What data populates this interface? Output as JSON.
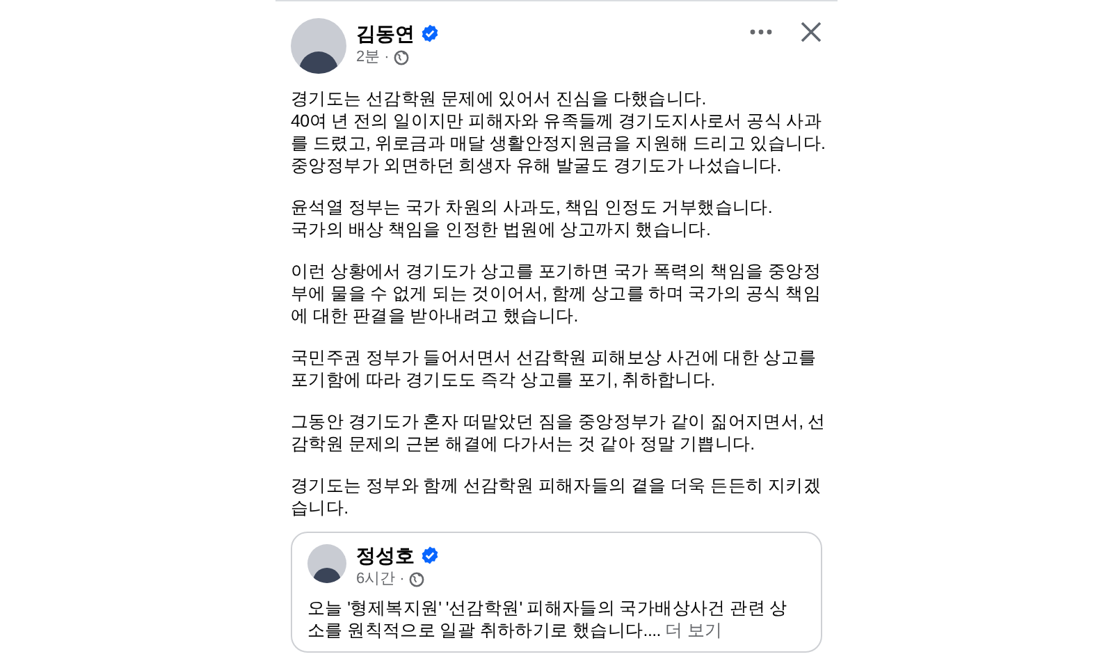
{
  "post": {
    "author": "김동연",
    "verified": true,
    "time": "2분",
    "separator": "·",
    "paragraphs": [
      [
        "경기도는 선감학원 문제에 있어서 진심을 다했습니다.",
        "40여 년 전의 일이지만 피해자와 유족들께 경기도지사로서 공식 사과",
        "를 드렸고, 위로금과 매달 생활안정지원금을 지원해 드리고 있습니다.",
        "중앙정부가 외면하던 희생자 유해 발굴도 경기도가 나섰습니다."
      ],
      [
        "윤석열 정부는 국가 차원의 사과도, 책임 인정도 거부했습니다.",
        "국가의 배상 책임을 인정한 법원에 상고까지 했습니다."
      ],
      [
        "이런 상황에서 경기도가 상고를 포기하면 국가 폭력의 책임을 중앙정",
        "부에 물을 수 없게 되는 것이어서, 함께 상고를 하며 국가의 공식 책임",
        "에 대한 판결을 받아내려고 했습니다."
      ],
      [
        "국민주권 정부가 들어서면서 선감학원 피해보상 사건에 대한 상고를",
        "포기함에 따라 경기도도 즉각 상고를 포기, 취하합니다."
      ],
      [
        "그동안 경기도가 혼자 떠맡았던 짐을 중앙정부가 같이 짊어지면서, 선",
        "감학원 문제의 근본 해결에 다가서는 것 같아 정말 기쁩니다."
      ],
      [
        "경기도는 정부와 함께 선감학원 피해자들의 곁을 더욱 든든히 지키겠",
        "습니다."
      ]
    ],
    "shared": {
      "author": "정성호",
      "verified": true,
      "time": "6시간",
      "separator": "·",
      "lines": [
        "오늘 '형제복지원' '선감학원' 피해자들의 국가배상사건 관련 상",
        "소를 원칙적으로 일괄 취하하기로 했습니다...."
      ],
      "more": "더 보기"
    }
  }
}
